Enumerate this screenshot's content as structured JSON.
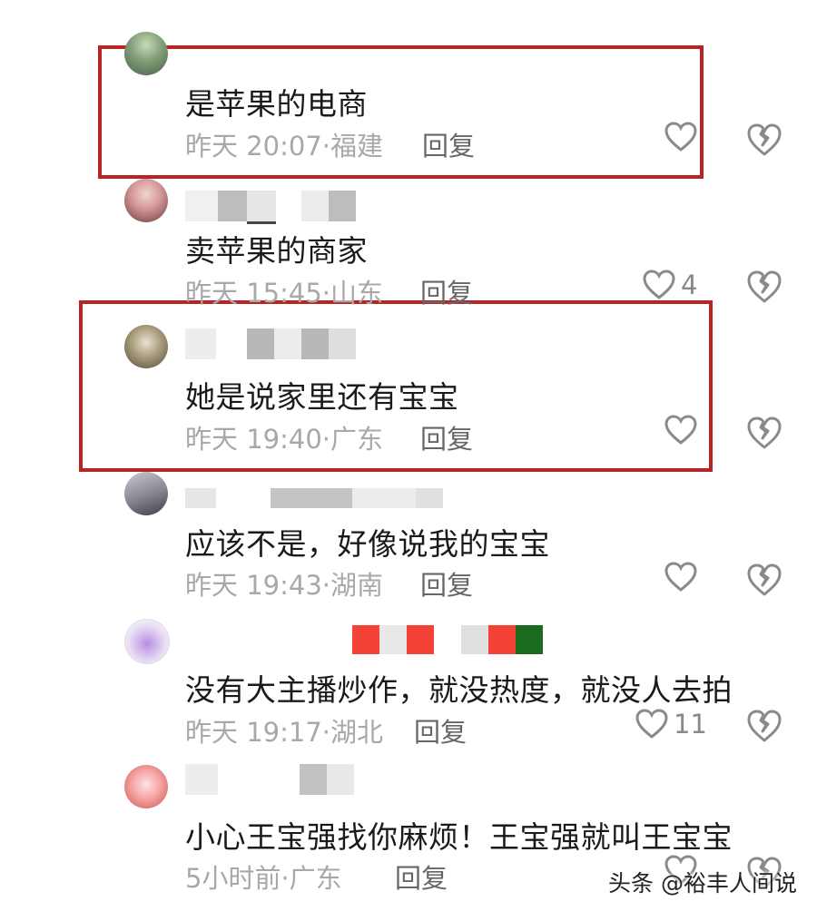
{
  "comments": [
    {
      "text": "是苹果的电商",
      "time": "昨天 20:07",
      "location": "福建",
      "reply": "回复",
      "likes": ""
    },
    {
      "text": "卖苹果的商家",
      "time": "昨天 15:45",
      "location": "山东",
      "reply": "回复",
      "likes": "4"
    },
    {
      "text": "她是说家里还有宝宝",
      "time": "昨天 19:40",
      "location": "广东",
      "reply": "回复",
      "likes": ""
    },
    {
      "text": "应该不是，好像说我的宝宝",
      "time": "昨天 19:43",
      "location": "湖南",
      "reply": "回复",
      "likes": ""
    },
    {
      "text": "没有大主播炒作，就没热度，就没人去拍",
      "time": "昨天 19:17",
      "location": "湖北",
      "reply": "回复",
      "likes": "11"
    },
    {
      "text": "小心王宝强找你麻烦！王宝强就叫王宝宝",
      "time": "5小时前",
      "location": "广东",
      "reply": "回复",
      "likes": ""
    }
  ],
  "meta_sep": "·",
  "watermark": "头条 @裕丰人间说",
  "colors": {
    "highlight": "#b62424",
    "icon": "#8a8a8a"
  }
}
